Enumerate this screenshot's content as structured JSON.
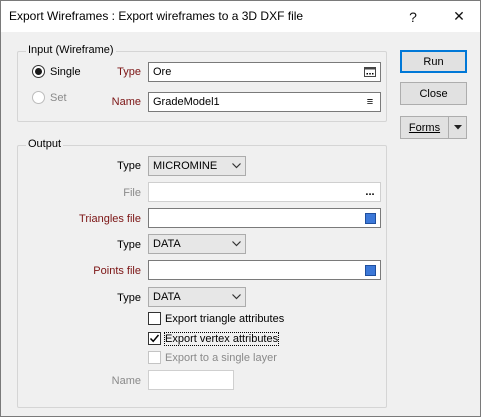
{
  "window": {
    "title": "Export Wireframes : Export wireframes to a 3D DXF file",
    "help_glyph": "?",
    "close_glyph": "✕"
  },
  "input_group": {
    "label": "Input (Wireframe)",
    "single_label": "Single",
    "set_label": "Set",
    "selected_mode": "Single",
    "type_label": "Type",
    "type_value": "Ore",
    "name_label": "Name",
    "name_value": "GradeModel1"
  },
  "output_group": {
    "label": "Output",
    "type1_label": "Type",
    "type1_value": "MICROMINE",
    "file_label": "File",
    "file_value": "",
    "triangles_label": "Triangles file",
    "triangles_value": "",
    "type2_label": "Type",
    "type2_value": "DATA",
    "points_label": "Points file",
    "points_value": "",
    "type3_label": "Type",
    "type3_value": "DATA",
    "export_triangle_attrs": {
      "label": "Export triangle attributes",
      "checked": false
    },
    "export_vertex_attrs": {
      "label": "Export vertex attributes",
      "checked": true
    },
    "export_single_layer": {
      "label": "Export to a single layer",
      "checked": false,
      "enabled": false
    },
    "name_label": "Name",
    "name_value": ""
  },
  "buttons": {
    "run_label": "Run",
    "close_label": "Close",
    "forms_label": "Forms"
  },
  "colors": {
    "required_label": "#7b1414",
    "default_button_border": "#0078d7",
    "file_picker_blue": "#3c78d8"
  },
  "icons": {
    "ellipsis": "...",
    "list": "≡"
  }
}
